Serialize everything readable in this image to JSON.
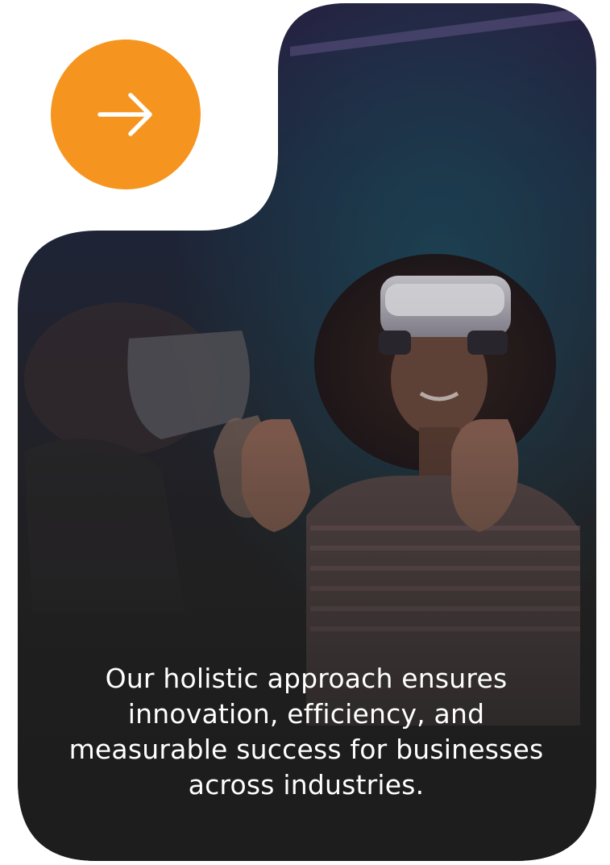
{
  "card": {
    "image_description_icon": "vr-headset-photo",
    "caption": "Our holistic approach ensures innovation, efficiency, and measurable success for businesses across industries."
  },
  "arrow_button": {
    "icon": "arrow-right-icon"
  },
  "colors": {
    "accent": "#F5951F",
    "text": "#FFFFFF",
    "card_dark": "#232323",
    "photo_top": "#2A2147"
  }
}
